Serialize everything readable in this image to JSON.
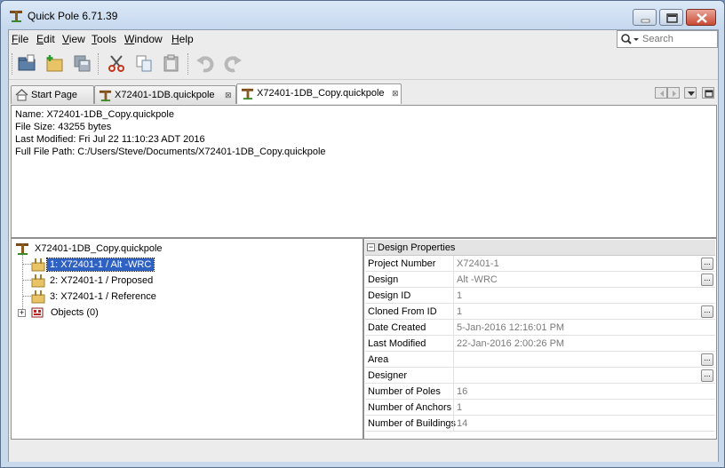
{
  "app": {
    "title": "Quick Pole 6.71.39"
  },
  "menu": [
    {
      "label_u": "F",
      "label_rest": "ile"
    },
    {
      "label_u": "E",
      "label_rest": "dit"
    },
    {
      "label_u": "V",
      "label_rest": "iew"
    },
    {
      "label_u": "T",
      "label_rest": "ools"
    },
    {
      "label_u": "W",
      "label_rest": "indow"
    },
    {
      "label_u": "H",
      "label_rest": "elp"
    }
  ],
  "search": {
    "placeholder": "Search"
  },
  "toolbar": {
    "icons": [
      "open-folder-icon",
      "new-project-icon",
      "save-icon",
      "cut-icon",
      "copy-icon",
      "paste-icon",
      "undo-icon",
      "redo-icon"
    ]
  },
  "tabs": [
    {
      "label": "Start Page"
    },
    {
      "label": "X72401-1DB.quickpole"
    },
    {
      "label": "X72401-1DB_Copy.quickpole"
    }
  ],
  "tab_close_glyph": "⊠",
  "info": {
    "name": "Name: X72401-1DB_Copy.quickpole",
    "size": "File Size: 43255 bytes",
    "modified": "Last Modified: Fri Jul 22 11:10:23 ADT 2016",
    "path": "Full File Path: C:/Users/Steve/Documents/X72401-1DB_Copy.quickpole"
  },
  "tree": {
    "root": "X72401-1DB_Copy.quickpole",
    "designs": [
      {
        "label": "1: X72401-1 / Alt -WRC"
      },
      {
        "label": "2: X72401-1 / Proposed"
      },
      {
        "label": "3: X72401-1 / Reference"
      }
    ],
    "objects": "Objects (0)",
    "expand_glyph": "+"
  },
  "properties": {
    "header": "Design Properties",
    "collapse_glyph": "−",
    "ellipsis_glyph": "...",
    "rows": [
      {
        "key": "Project Number",
        "value": "X72401-1",
        "button": true
      },
      {
        "key": "Design",
        "value": "Alt -WRC",
        "button": true
      },
      {
        "key": "Design ID",
        "value": "1",
        "button": false
      },
      {
        "key": "Cloned From ID",
        "value": "1",
        "button": true
      },
      {
        "key": "Date Created",
        "value": "5-Jan-2016 12:16:01 PM",
        "button": false
      },
      {
        "key": "Last Modified",
        "value": "22-Jan-2016 2:00:26 PM",
        "button": false
      },
      {
        "key": "Area",
        "value": "",
        "button": true
      },
      {
        "key": "Designer",
        "value": "",
        "button": true
      },
      {
        "key": "Number of Poles",
        "value": "16",
        "button": false
      },
      {
        "key": "Number of Anchors",
        "value": "1",
        "button": false
      },
      {
        "key": "Number of Buildings",
        "value": "14",
        "button": false
      }
    ]
  },
  "colors": {
    "selection": "#2f61c3",
    "close_red": "#c94a34"
  }
}
